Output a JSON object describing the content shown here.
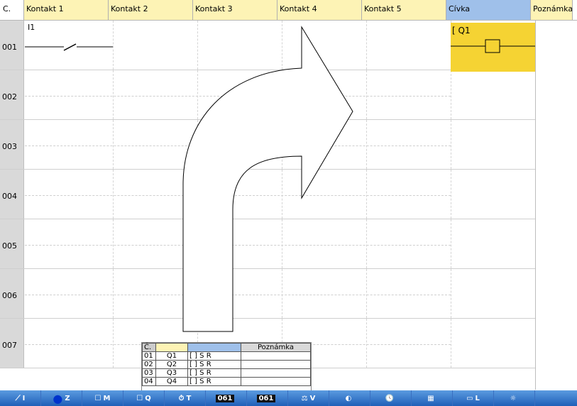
{
  "header": {
    "col_num": "C.",
    "contacts": [
      "Kontakt 1",
      "Kontakt 2",
      "Kontakt 3",
      "Kontakt 4",
      "Kontakt 5"
    ],
    "coil": "Cívka",
    "note": "Poznámka"
  },
  "rows": [
    "001",
    "002",
    "003",
    "004",
    "005",
    "006",
    "007"
  ],
  "row1": {
    "contact_label": "I1",
    "coil_label": "Q1"
  },
  "popup": {
    "head": [
      "Č.",
      "",
      "",
      "Poznámka"
    ],
    "items": [
      {
        "n": "01",
        "name": "Q1",
        "s": "S",
        "r": "R"
      },
      {
        "n": "02",
        "name": "Q2",
        "s": "S",
        "r": "R"
      },
      {
        "n": "03",
        "name": "Q3",
        "s": "S",
        "r": "R"
      },
      {
        "n": "04",
        "name": "Q4",
        "s": "S",
        "r": "R"
      }
    ]
  },
  "toolbar": {
    "items": [
      {
        "icon": "contact-icon",
        "label": "I"
      },
      {
        "icon": "blue-circle-icon",
        "label": "Z"
      },
      {
        "icon": "box-m-icon",
        "label": "M"
      },
      {
        "icon": "box-q-icon",
        "label": "Q"
      },
      {
        "icon": "timer-icon",
        "label": "T"
      },
      {
        "icon": "counter-icon",
        "label": ""
      },
      {
        "icon": "counter2-icon",
        "label": ""
      },
      {
        "icon": "compare-icon",
        "label": "V"
      },
      {
        "icon": "meter-icon",
        "label": ""
      },
      {
        "icon": "clock-icon",
        "label": ""
      },
      {
        "icon": "display-icon",
        "label": ""
      },
      {
        "icon": "lcd-icon",
        "label": "L"
      },
      {
        "icon": "light-icon",
        "label": ""
      }
    ]
  },
  "colors": {
    "coil_bg": "#f5d333",
    "header_bg": "#fdf3b5",
    "coil_hdr": "#9fc0ea",
    "toolbar": "#2f6fc8"
  }
}
